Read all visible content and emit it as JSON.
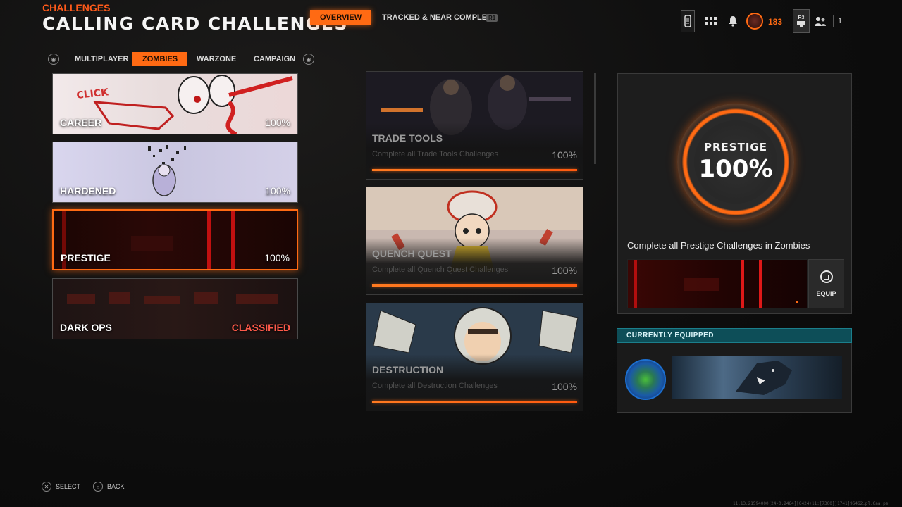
{
  "header": {
    "breadcrumb": "CHALLENGES",
    "title": "CALLING CARD CHALLENGES",
    "nav": [
      {
        "label": "OVERVIEW",
        "active": true
      },
      {
        "label": "TRACKED & NEAR COMPLETE",
        "active": false
      }
    ],
    "r1_hint": "R1",
    "rank_value": "183",
    "r3_hint": "R3",
    "party_count": "1"
  },
  "tabs": [
    {
      "label": "MULTIPLAYER",
      "active": false
    },
    {
      "label": "ZOMBIES",
      "active": true
    },
    {
      "label": "WARZONE",
      "active": false
    },
    {
      "label": "CAMPAIGN",
      "active": false
    }
  ],
  "categories": [
    {
      "label": "CAREER",
      "value": "100%"
    },
    {
      "label": "HARDENED",
      "value": "100%"
    },
    {
      "label": "PRESTIGE",
      "value": "100%",
      "selected": true
    },
    {
      "label": "DARK OPS",
      "value": "CLASSIFIED"
    }
  ],
  "challenges": [
    {
      "title": "TRADE TOOLS",
      "description": "Complete all Trade Tools Challenges",
      "value": "100%",
      "progress": 1.0
    },
    {
      "title": "QUENCH QUEST",
      "description": "Complete all Quench Quest Challenges",
      "value": "100%",
      "progress": 1.0
    },
    {
      "title": "DESTRUCTION",
      "description": "Complete all Destruction Challenges",
      "value": "100%",
      "progress": 1.0
    }
  ],
  "detail": {
    "ring_label": "PRESTIGE",
    "ring_value": "100%",
    "description": "Complete all Prestige Challenges in Zombies",
    "equip_label": "EQUIP"
  },
  "equipped": {
    "header": "CURRENTLY EQUIPPED"
  },
  "footer": {
    "select_label": "SELECT",
    "back_label": "BACK",
    "build_info": "11.13.21594000[24-0.2464][0424+11:[7300]]1741]96462.pl.Gaa.ps"
  },
  "colors": {
    "accent": "#ff6a13",
    "crumb": "#ff5a1a",
    "classified": "#ff5a4a",
    "equipped_header": "#0d4e58"
  }
}
